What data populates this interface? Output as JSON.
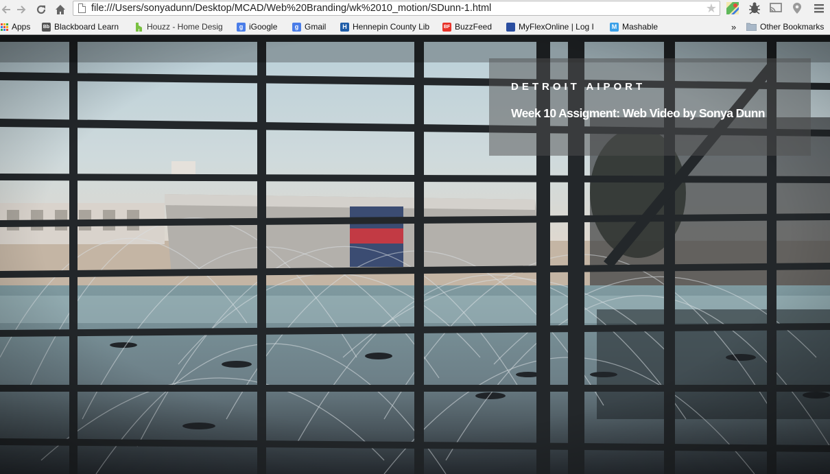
{
  "browser": {
    "url": "file:///Users/sonyadunn/Desktop/MCAD/Web%20Branding/wk%2010_motion/SDunn-1.html",
    "nav_icons": [
      "back-icon",
      "forward-icon",
      "reload-icon",
      "home-icon"
    ],
    "extension_icons": [
      "maps-icon",
      "bug-icon",
      "cast-icon",
      "location-pin-icon",
      "menu-icon"
    ]
  },
  "bookmarks": {
    "items": [
      {
        "label": "Apps",
        "icon": "apps-grid-icon"
      },
      {
        "label": "Blackboard Learn",
        "icon": "blackboard-icon",
        "badge": "Bb",
        "color": "#555555"
      },
      {
        "label": "Houzz - Home Desig",
        "icon": "houzz-icon",
        "color": "#7ac142"
      },
      {
        "label": "iGoogle",
        "icon": "google-icon",
        "badge": "g",
        "color": "#4a7de8"
      },
      {
        "label": "Gmail",
        "icon": "google-icon",
        "badge": "g",
        "color": "#4a7de8"
      },
      {
        "label": "Hennepin County Lib",
        "icon": "hennepin-icon",
        "badge": "H",
        "color": "#1f5da8"
      },
      {
        "label": "BuzzFeed",
        "icon": "buzzfeed-icon",
        "badge": "BF",
        "color": "#e8332a"
      },
      {
        "label": "MyFlexOnline | Log I",
        "icon": "myflex-icon",
        "color": "#2b4ea0"
      },
      {
        "label": "Mashable",
        "icon": "mashable-icon",
        "badge": "M",
        "color": "#3aa0e8"
      }
    ],
    "overflow": "»",
    "other": "Other Bookmarks"
  },
  "hero": {
    "title": "DETROIT AIPORT",
    "subtitle": "Week 10 Assigment: Web Video by Sonya Dunn"
  }
}
